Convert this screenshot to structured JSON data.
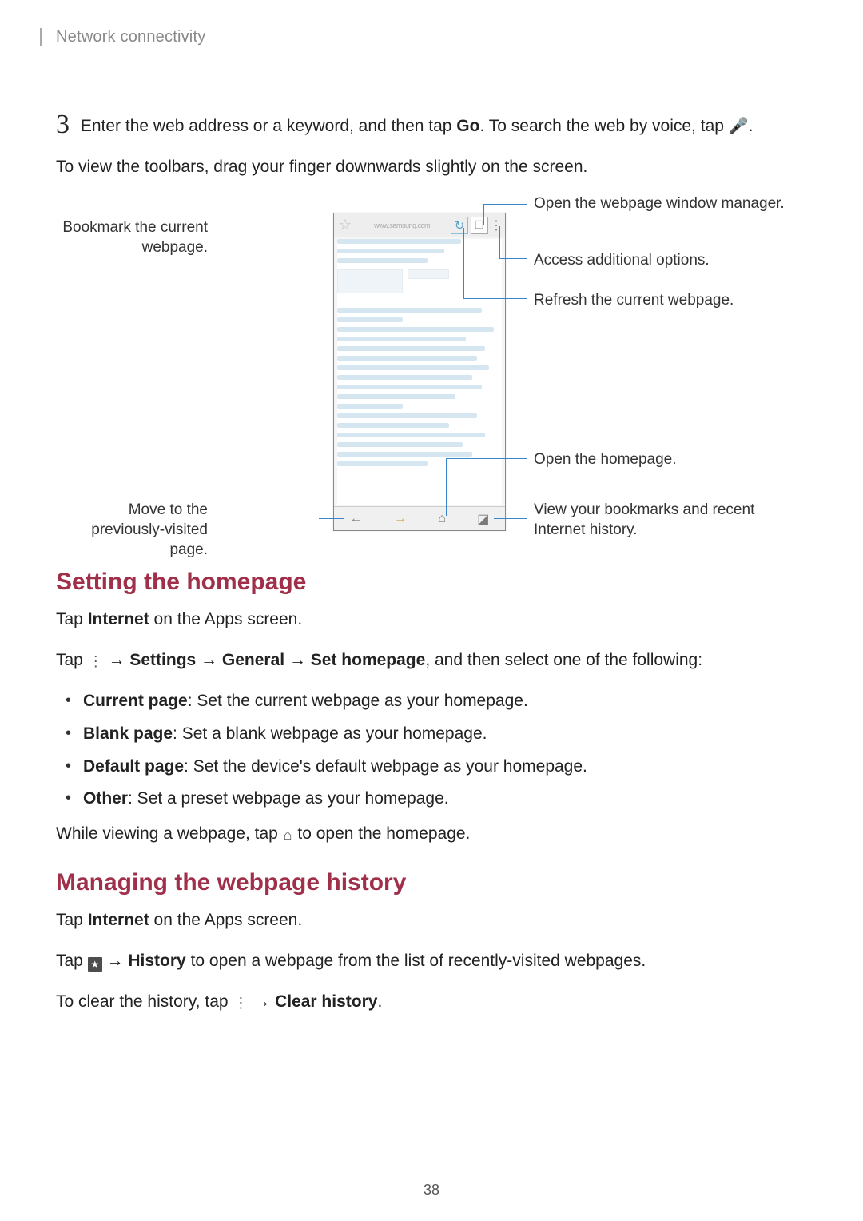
{
  "breadcrumb": "Network connectivity",
  "step3": {
    "number": "3",
    "text_a": "Enter the web address or a keyword, and then tap ",
    "text_b": "Go",
    "text_c": ". To search the web by voice, tap ",
    "text_d": "."
  },
  "toolbars_note": "To view the toolbars, drag your finger downwards slightly on the screen.",
  "diagram": {
    "labels": {
      "bookmark": "Bookmark the current webpage.",
      "prev_page": "Move to the previously-visited page.",
      "window_mgr": "Open the webpage window manager.",
      "more_options": "Access additional options.",
      "refresh": "Refresh the current webpage.",
      "homepage": "Open the homepage.",
      "bookmarks_history": "View your bookmarks and recent Internet history."
    },
    "addrbar_url": "www.samsung.com"
  },
  "section1": {
    "heading": "Setting the homepage",
    "p1_a": "Tap ",
    "p1_b": "Internet",
    "p1_c": " on the Apps screen.",
    "p2_a": "Tap ",
    "p2_b": " → ",
    "p2_c": "Settings",
    "p2_d": " → ",
    "p2_e": "General",
    "p2_f": " → ",
    "p2_g": "Set homepage",
    "p2_h": ", and then select one of the following:",
    "options": [
      {
        "label": "Current page",
        "desc": ": Set the current webpage as your homepage."
      },
      {
        "label": "Blank page",
        "desc": ": Set a blank webpage as your homepage."
      },
      {
        "label": "Default page",
        "desc": ": Set the device's default webpage as your homepage."
      },
      {
        "label": "Other",
        "desc": ": Set a preset webpage as your homepage."
      }
    ],
    "p3_a": "While viewing a webpage, tap ",
    "p3_b": " to open the homepage."
  },
  "section2": {
    "heading": "Managing the webpage history",
    "p1_a": "Tap ",
    "p1_b": "Internet",
    "p1_c": " on the Apps screen.",
    "p2_a": "Tap ",
    "p2_b": " → ",
    "p2_c": "History",
    "p2_d": " to open a webpage from the list of recently-visited webpages.",
    "p3_a": "To clear the history, tap ",
    "p3_b": " → ",
    "p3_c": "Clear history",
    "p3_d": "."
  },
  "page_number": "38"
}
